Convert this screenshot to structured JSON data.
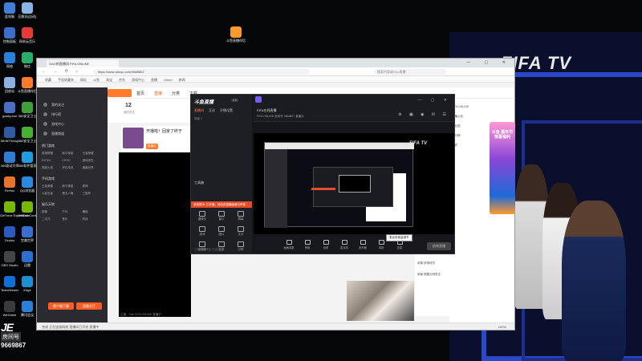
{
  "desktop": {
    "icons": [
      {
        "label": "此电脑",
        "color": "#3f7fd8"
      },
      {
        "label": "回收站(自动)",
        "color": "#89b4e6"
      },
      {
        "label": "控制面板",
        "color": "#3b6ecb"
      },
      {
        "label": "网易云音乐",
        "color": "#e33a3a"
      },
      {
        "label": "网络",
        "color": "#2a7fd8"
      },
      {
        "label": "微信",
        "color": "#2aae67"
      },
      {
        "label": "回收站",
        "color": "#8db2e0"
      },
      {
        "label": "斗鱼直播伴侣",
        "color": "#ff7a2b"
      },
      {
        "label": "goaby.exe",
        "color": "#4a6fc0"
      },
      {
        "label": "360安全卫士",
        "color": "#3fa03a"
      },
      {
        "label": "WinNTSetup",
        "color": "#2d5aa0"
      },
      {
        "label": "360安全卫士",
        "color": "#46b034"
      },
      {
        "label": "360驱动大师",
        "color": "#2f7dd2"
      },
      {
        "label": "360软件管家",
        "color": "#1f9be0"
      },
      {
        "label": "Firefox",
        "color": "#e8732b"
      },
      {
        "label": "QQ浏览器",
        "color": "#2b8ae0"
      },
      {
        "label": "GeForce Experience",
        "color": "#76b900"
      },
      {
        "label": "NVIDIA Control",
        "color": "#76b900"
      },
      {
        "label": "Oculus",
        "color": "#2a5ac0"
      },
      {
        "label": "完美世界",
        "color": "#3a6fd0"
      },
      {
        "label": "OBS Studio",
        "color": "#444444"
      },
      {
        "label": "迅雷",
        "color": "#2c6fd2"
      },
      {
        "label": "TeamViewer",
        "color": "#0e6fd8"
      },
      {
        "label": "Edge",
        "color": "#1f8fd4"
      },
      {
        "label": "WeGame",
        "color": "#3a3a3a"
      },
      {
        "label": "腾讯会议",
        "color": "#2a7fd8"
      }
    ],
    "file_icon_label": "斗鱼直播伴侣",
    "counter": {
      "logo": "JE",
      "tag": "房间号",
      "number": "9669867"
    },
    "wallpaper_brand": "FIFA TV"
  },
  "browser": {
    "tab_title": "GAO的直播间 FIFA ONLINE",
    "url": "https://www.douyu.com/9669867",
    "search_placeholder": "搜索内容或Gao直播",
    "bookmarks": [
      "收藏",
      "手机收藏夹",
      "网址",
      "斗鱼",
      "淘宝",
      "京东",
      "游戏中心",
      "直播",
      "Gihen",
      "新闻"
    ],
    "status_text": "完成 正在连接网络 直播间已开启 直播中",
    "zoom": "100%"
  },
  "douyu": {
    "header_items": [
      "首页",
      "直播",
      "分类",
      "下载"
    ],
    "nav": [
      "我的关注",
      "排行榜",
      "游戏中心",
      "直播频道"
    ],
    "categories": [
      {
        "title": "热门游戏",
        "items": [
          "英雄联盟",
          "和平精英",
          "王者荣耀",
          "DOTA2",
          "CSGO",
          "绝地求生",
          "穿越火线",
          "炉石传说",
          "魔兽世界"
        ]
      },
      {
        "title": "手机游戏",
        "items": [
          "王者荣耀",
          "和平精英",
          "原神",
          "火影忍者",
          "第五人格",
          "三国杀"
        ]
      },
      {
        "title": "娱乐天地",
        "items": [
          "颜值",
          "户外",
          "舞蹈",
          "二次元",
          "音乐",
          "科技"
        ]
      }
    ],
    "left_buttons": [
      "客户端下载",
      "直播大厅"
    ],
    "profile_count": "12",
    "profile_label": "我的关注",
    "card_title": "开播啦！回家了终于",
    "card_tag": "直播中",
    "right_rows": [
      "FIFA ONLINE",
      "主播公告",
      "粉丝团",
      "排行榜",
      "贵宾"
    ],
    "promo_text": "斗鱼 嘉年华 惊喜福利",
    "chat": [
      "欢迎来到直播间",
      "弹幕：球员卡",
      "1号选手 上线",
      "主播 好厉害",
      "恭喜 获得球员",
      "房管 提醒文明发言"
    ],
    "stream_info": "主播：Gao  FIFA ONLINE 直播中"
  },
  "tool": {
    "logo": "斗鱼直播",
    "version": "2.0",
    "tabs": [
      "直播间",
      "互动",
      "开播设置"
    ],
    "active_tab": 0,
    "scene_label": "场景 1",
    "source_label": "工具箱",
    "alert": "系统提示: 已开播，请检查直播画面与声音",
    "tiles": [
      "摄像头",
      "窗口",
      "屏幕",
      "游戏",
      "图片",
      "文字",
      "多媒体",
      "连麦",
      "分享"
    ],
    "footer": "斗鱼直播伴侣 已连接",
    "room_title": "FIFA在线直播",
    "room_meta": "FIFA ONLINE  房间号 9669867  直播中",
    "bottom_items": [
      "画面调整",
      "美颜",
      "滤镜",
      "麦克风",
      "扬声器",
      "录制",
      "连麦"
    ],
    "live_button": "结束直播",
    "tooltip": "麦克风音量调节"
  }
}
